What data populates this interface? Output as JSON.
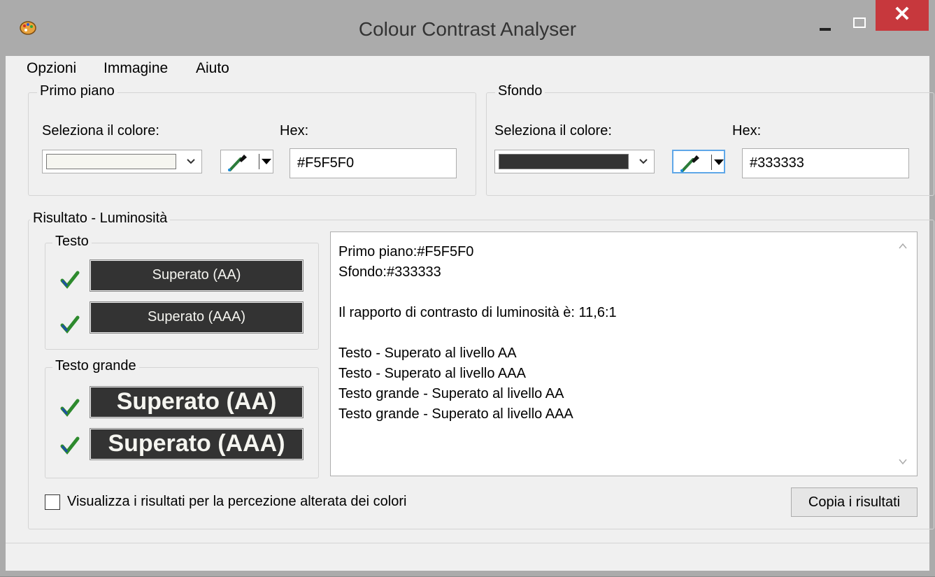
{
  "window": {
    "title": "Colour Contrast Analyser"
  },
  "menu": [
    "Opzioni",
    "Immagine",
    "Aiuto"
  ],
  "foreground": {
    "group_title": "Primo piano",
    "select_label": "Seleziona il colore:",
    "hex_label": "Hex:",
    "hex_value": "#F5F5F0",
    "swatch_color": "#F5F5F0"
  },
  "background": {
    "group_title": "Sfondo",
    "select_label": "Seleziona il colore:",
    "hex_label": "Hex:",
    "hex_value": "#333333",
    "swatch_color": "#333333"
  },
  "result": {
    "group_title": "Risultato - Luminosità",
    "text_group": "Testo",
    "text_aa": "Superato (AA)",
    "text_aaa": "Superato (AAA)",
    "large_group": "Testo grande",
    "large_aa": "Superato (AA)",
    "large_aaa": "Superato (AAA)",
    "details": [
      "Primo piano:#F5F5F0",
      "Sfondo:#333333",
      "",
      "Il rapporto di contrasto di luminosità è: 11,6:1",
      "",
      "Testo - Superato al livello AA",
      "Testo - Superato al livello AAA",
      "Testo grande - Superato al livello AA",
      "Testo grande - Superato al livello AAA"
    ]
  },
  "colorblind_checkbox": {
    "label": "Visualizza i risultati per la percezione alterata dei colori",
    "checked": false
  },
  "copy_button": "Copia i risultati",
  "icons": {
    "app": "palette-icon",
    "picker": "eyedropper-icon",
    "check": "checkmark-icon"
  }
}
